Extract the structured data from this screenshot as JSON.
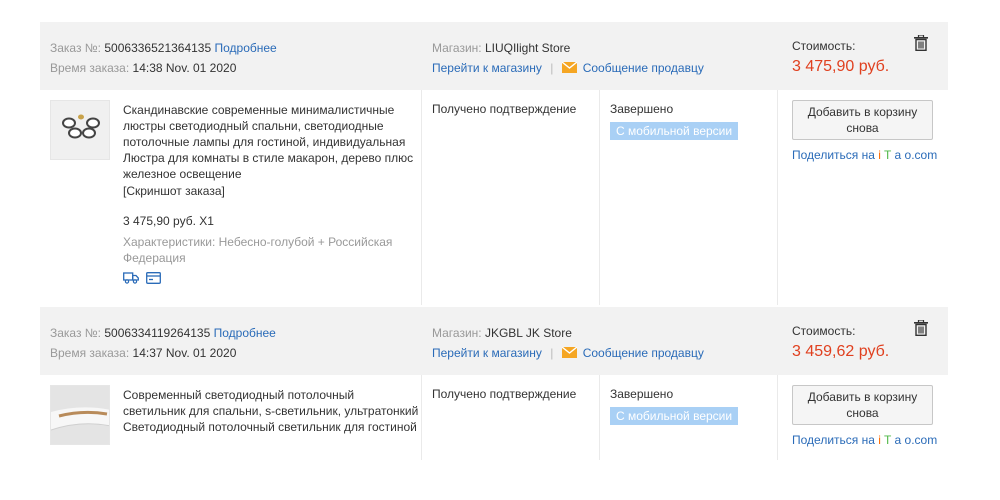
{
  "orders": [
    {
      "order_no_label": "Заказ №:",
      "order_no": "5006336521364135",
      "details_link": "Подробнее",
      "time_label": "Время заказа:",
      "time": "14:38 Nov. 01 2020",
      "store_label": "Магазин:",
      "store": "LIUQIlight Store",
      "go_store": "Перейти к магазину",
      "message_seller": "Сообщение продавцу",
      "cost_label": "Стоимость:",
      "cost": "3 475,90 руб.",
      "product_title": "Скандинавские современные минималистичные люстры светодиодный спальни, светодиодные потолочные лампы для гостиной, индивидуальная Люстра для комнаты в стиле макарон, дерево плюс железное освещение",
      "snapshot": "[Скриншот заказа]",
      "price_qty": "3 475,90 руб. X1",
      "attributes": "Характеристики: Небесно-голубой + Российская Федерация",
      "status": "Получено подтверждение",
      "completion": "Завершено",
      "mobile_badge": "С мобильной версии",
      "add_to_cart": "Добавить в корзину снова",
      "share_prefix": "Поделиться на ",
      "share_i": "i",
      "share_t": "T",
      "share_a": "a",
      "share_o": "o.com"
    },
    {
      "order_no_label": "Заказ №:",
      "order_no": "5006334119264135",
      "details_link": "Подробнее",
      "time_label": "Время заказа:",
      "time": "14:37 Nov. 01 2020",
      "store_label": "Магазин:",
      "store": "JKGBL JK Store",
      "go_store": "Перейти к магазину",
      "message_seller": "Сообщение продавцу",
      "cost_label": "Стоимость:",
      "cost": "3 459,62 руб.",
      "product_title": "Современный светодиодный потолочный светильник для спальни, s-светильник, ультратонкий Светодиодный потолочный светильник для гостиной",
      "status": "Получено подтверждение",
      "completion": "Завершено",
      "mobile_badge": "С мобильной версии",
      "add_to_cart": "Добавить в корзину снова",
      "share_prefix": "Поделиться на ",
      "share_i": "i",
      "share_t": "T",
      "share_a": "a",
      "share_o": "o.com"
    }
  ],
  "icons": {
    "delete": "trash-icon",
    "message": "envelope-icon",
    "shipping": "truck-icon",
    "payment": "card-icon"
  },
  "colors": {
    "link": "#2a6bb8",
    "price": "#e0401f",
    "badge": "#a9d0f5",
    "header_bg": "#f2f2f2",
    "envelope": "#f5a623"
  }
}
